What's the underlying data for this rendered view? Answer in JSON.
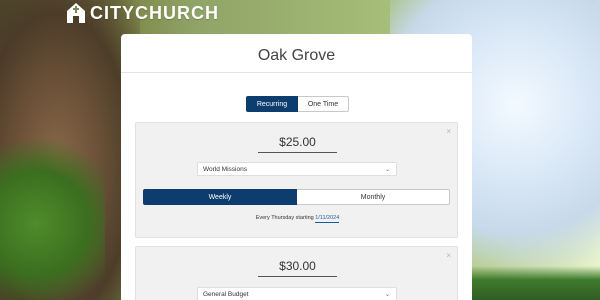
{
  "brand": {
    "logo_text": "CITYCHURCH"
  },
  "church": {
    "name": "Oak Grove"
  },
  "giving_type": {
    "options": [
      "Recurring",
      "One Time"
    ],
    "selected": "Recurring"
  },
  "gifts": [
    {
      "amount": "$25.00",
      "fund": "World Missions",
      "frequency": {
        "options": [
          "Weekly",
          "Monthly"
        ],
        "selected": "Weekly"
      },
      "schedule_prefix": "Every Thursday starting",
      "start_date": "1/11/2024"
    },
    {
      "amount": "$30.00",
      "fund": "General Budget"
    }
  ],
  "icons": {
    "close": "×",
    "chevron": "⌄"
  },
  "colors": {
    "primary": "#0d3d6e",
    "link": "#1d5a9a"
  }
}
